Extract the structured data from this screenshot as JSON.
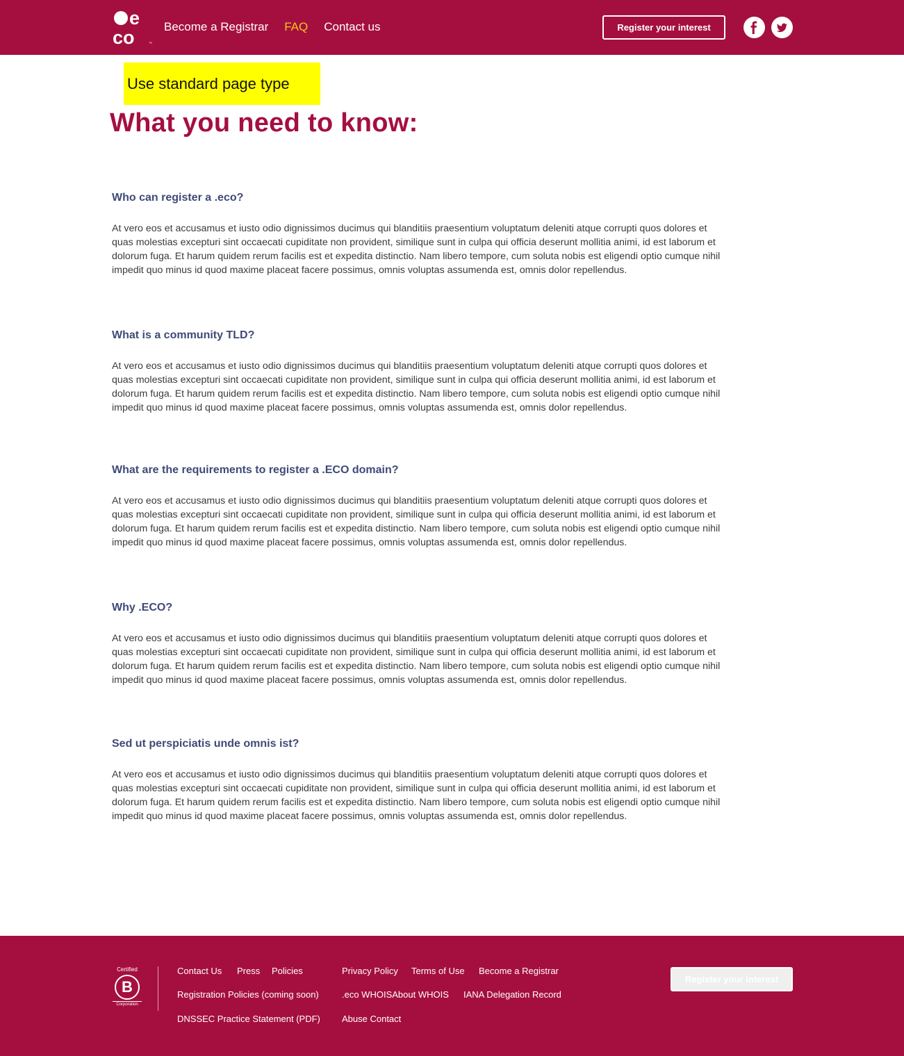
{
  "header": {
    "nav": [
      "Become a Registrar",
      "FAQ",
      "Contact us"
    ],
    "register_button": "Register your interest",
    "social_icons": [
      "facebook-icon",
      "twitter-icon"
    ],
    "brand_color": "#a50f40",
    "active_nav_color": "#f5c518"
  },
  "note": "Use standard page type",
  "page_title": "What you need to know:",
  "faqs": [
    {
      "question": "Who can register a .eco?",
      "answer": "At vero eos et accusamus et iusto odio dignissimos ducimus qui blanditiis praesentium voluptatum deleniti atque corrupti quos dolores et quas molestias excepturi sint occaecati cupiditate non provident, similique sunt in culpa qui officia deserunt mollitia animi, id est laborum et dolorum fuga. Et harum quidem rerum facilis est et expedita distinctio. Nam libero tempore, cum soluta nobis est eligendi optio cumque nihil impedit quo minus id quod maxime placeat facere possimus, omnis voluptas assumenda est, omnis dolor repellendus."
    },
    {
      "question": "What is a community TLD?",
      "answer": "At vero eos et accusamus et iusto odio dignissimos ducimus qui blanditiis praesentium voluptatum deleniti atque corrupti quos dolores et quas molestias excepturi sint occaecati cupiditate non provident, similique sunt in culpa qui officia deserunt mollitia animi, id est laborum et dolorum fuga. Et harum quidem rerum facilis est et expedita distinctio. Nam libero tempore, cum soluta nobis est eligendi optio cumque nihil impedit quo minus id quod maxime placeat facere possimus, omnis voluptas assumenda est, omnis dolor repellendus."
    },
    {
      "question": "What are the requirements to register a .ECO domain?",
      "answer": "At vero eos et accusamus et iusto odio dignissimos ducimus qui blanditiis praesentium voluptatum deleniti atque corrupti quos dolores et quas molestias excepturi sint occaecati cupiditate non provident, similique sunt in culpa qui officia deserunt mollitia animi, id est laborum et dolorum fuga. Et harum quidem rerum facilis est et expedita distinctio. Nam libero tempore, cum soluta nobis est eligendi optio cumque nihil impedit quo minus id quod maxime placeat facere possimus, omnis voluptas assumenda est, omnis dolor repellendus."
    },
    {
      "question": "Why .ECO?",
      "answer": "At vero eos et accusamus et iusto odio dignissimos ducimus qui blanditiis praesentium voluptatum deleniti atque corrupti quos dolores et quas molestias excepturi sint occaecati cupiditate non provident, similique sunt in culpa qui officia deserunt mollitia animi, id est laborum et dolorum fuga. Et harum quidem rerum facilis est et expedita distinctio. Nam libero tempore, cum soluta nobis est eligendi optio cumque nihil impedit quo minus id quod maxime placeat facere possimus, omnis voluptas assumenda est, omnis dolor repellendus."
    },
    {
      "question": "Sed ut perspiciatis unde omnis ist?",
      "answer": "At vero eos et accusamus et iusto odio dignissimos ducimus qui blanditiis praesentium voluptatum deleniti atque corrupti quos dolores et quas molestias excepturi sint occaecati cupiditate non provident, similique sunt in culpa qui officia deserunt mollitia animi, id est laborum et dolorum fuga. Et harum quidem rerum facilis est et expedita distinctio. Nam libero tempore, cum soluta nobis est eligendi optio cumque nihil impedit quo minus id quod maxime placeat facere possimus, omnis voluptas assumenda est, omnis dolor repellendus."
    }
  ],
  "footer": {
    "bcorp": {
      "top": "Certified",
      "letter": "B",
      "bottom": "Corporation"
    },
    "links": {
      "contact_us": "Contact Us",
      "press": "Press",
      "policies": "Policies",
      "privacy": "Privacy Policy",
      "terms": "Terms of Use",
      "become_registrar": "Become a Registrar",
      "registration_policies": "Registration Policies (coming soon)",
      "whois": ".eco WHOISAbout WHOIS",
      "iana": "IANA Delegation Record",
      "dnssec": "DNSSEC Practice Statement (PDF)",
      "abuse": "Abuse Contact"
    },
    "register_button": "Register your interest"
  }
}
